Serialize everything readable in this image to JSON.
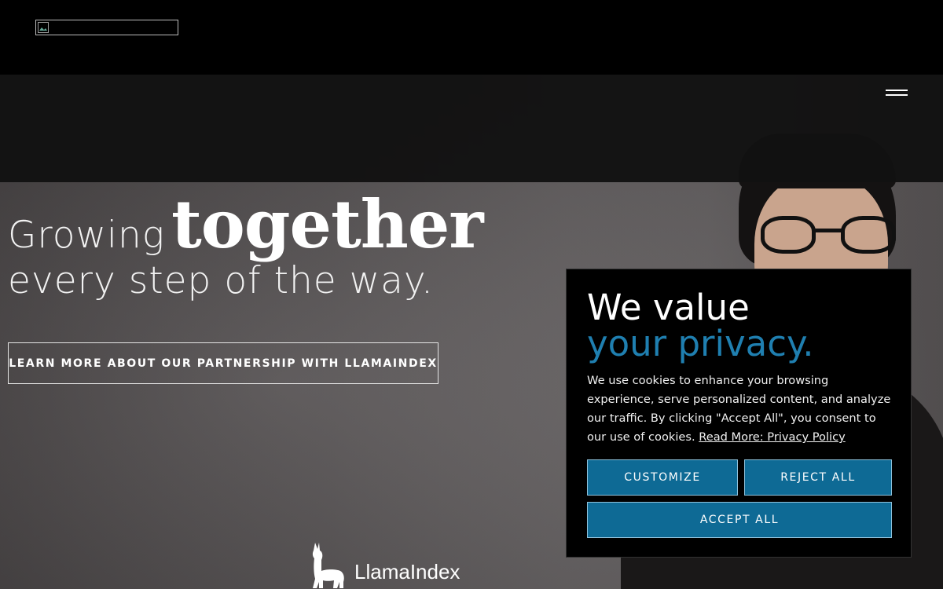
{
  "header": {
    "logo_alt": "",
    "menu_icon": "hamburger-menu-icon"
  },
  "hero": {
    "line1_light": "Growing",
    "line1_bold": "together",
    "line2": "every step of the way.",
    "cta_label": "LEARN MORE ABOUT OUR PARTNERSHIP WITH LLAMAINDEX",
    "partner_name": "LlamaIndex",
    "partner_icon": "llama-icon"
  },
  "cookie_banner": {
    "title_line1": "We value",
    "title_line2": "your privacy.",
    "body": "We use cookies to enhance your browsing experience, serve personalized content, and analyze our traffic. By clicking \"Accept All\", you consent to our use of cookies.",
    "link": "Read More: Privacy Policy",
    "customize_label": "CUSTOMIZE",
    "reject_label": "REJECT ALL",
    "accept_label": "ACCEPT ALL",
    "accent_color": "#1f7fb0",
    "button_color": "#0e6a95"
  }
}
